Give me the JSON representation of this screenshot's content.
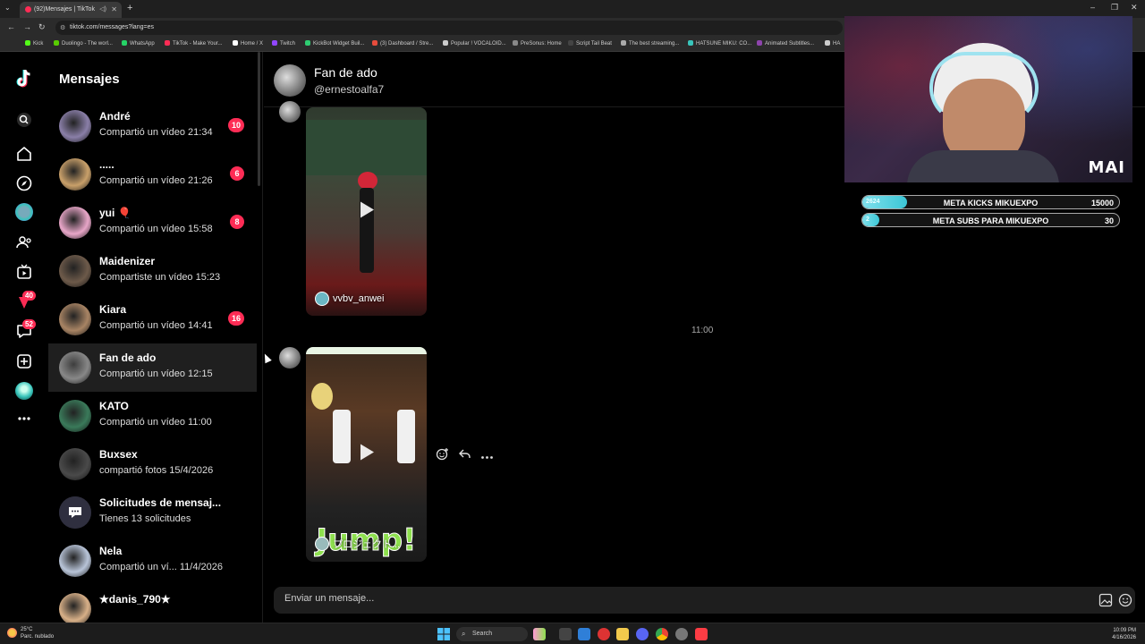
{
  "browser": {
    "tab_title": "(92)Mensajes | TikTok",
    "url": "tiktok.com/messages?lang=es",
    "bookmarks": [
      "Kick",
      "Duolingo - The worl...",
      "WhatsApp",
      "TikTok - Make Your...",
      "Home / X",
      "Twitch",
      "KickBot Widget Buil...",
      "(3) Dashboard / Stre...",
      "Popular ! VOCALOID...",
      "PreSonus: Home",
      "Script Tail Beat",
      "The best streaming...",
      "HATSUNE MIKU: CO...",
      "Animated Subtitles...",
      "HA"
    ],
    "bookmark_colors": [
      "#53fc18",
      "#58cc02",
      "#25d366",
      "#fe2c55",
      "#ffffff",
      "#9146ff",
      "#2ecc71",
      "#e74c3c",
      "#cccccc",
      "#888888",
      "#444444",
      "#aaaaaa",
      "#39c5bb",
      "#8e44ad",
      "#cccccc"
    ]
  },
  "rail": {
    "badges": {
      "messages_alerts": "40",
      "inbox": "52"
    }
  },
  "messages": {
    "title": "Mensajes",
    "conversations": [
      {
        "name": "André",
        "preview": "Compartió un vídeo 21:34",
        "badge": "10",
        "color": "#8a7fa8"
      },
      {
        "name": ".....",
        "preview": "Compartió un vídeo 21:26",
        "badge": "6",
        "color": "#c9a06a"
      },
      {
        "name": "yui 🎈",
        "preview": "Compartió un vídeo 15:58",
        "badge": "8",
        "color": "#e8a6c8"
      },
      {
        "name": "Maidenizer",
        "preview": "Compartiste un vídeo 15:23",
        "badge": "",
        "color": "#6d5a4a"
      },
      {
        "name": "Kiara",
        "preview": "Compartió un vídeo 14:41",
        "badge": "16",
        "color": "#a88464"
      },
      {
        "name": "Fan de ado",
        "preview": "Compartió un vídeo 12:15",
        "badge": "",
        "color": "#888888"
      },
      {
        "name": "KATO",
        "preview": "Compartió un vídeo 11:00",
        "badge": "",
        "color": "#3a7a5a"
      },
      {
        "name": "Buxsex",
        "preview": "compartió fotos 15/4/2026",
        "badge": "",
        "color": "#4a4a4a"
      },
      {
        "name": "Solicitudes de mensaj...",
        "preview": "Tienes 13 solicitudes",
        "badge": "",
        "color": "#2f2f3f"
      },
      {
        "name": "Nela",
        "preview": "Compartió un ví... 11/4/2026",
        "badge": "",
        "color": "#b8c4d8"
      },
      {
        "name": "★danis_790★",
        "preview": "",
        "badge": "",
        "color": "#d8b088"
      }
    ]
  },
  "chat": {
    "name": "Fan de ado",
    "handle": "@ernestoalfa7",
    "video1_caption": "vvbv_anwei",
    "time_separator": "11:00",
    "video2_caption": "プロジェクト...",
    "video2_banner": "Jump!",
    "composer_placeholder": "Enviar un mensaje..."
  },
  "overlay": {
    "logo": "MAI",
    "goals": [
      {
        "current": "2624",
        "label": "META KICKS MIKUEXPO",
        "target": "15000",
        "progress": 0.175
      },
      {
        "current": "2",
        "label": "META SUBS PARA MIKUEXPO",
        "target": "30",
        "progress": 0.067
      }
    ]
  },
  "taskbar": {
    "weather_temp": "25°C",
    "weather_desc": "Parc. nublado",
    "search_label": "Search",
    "time": "10:09 PM",
    "date": "4/16/2026"
  }
}
